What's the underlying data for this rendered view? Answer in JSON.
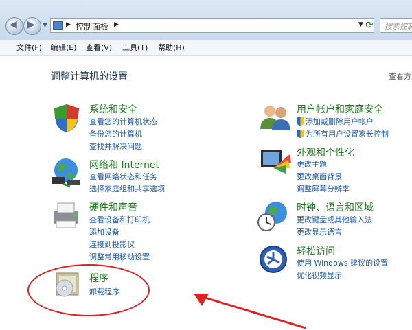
{
  "address": {
    "crumb": "控制面板",
    "search_placeholder": "搜索控制面"
  },
  "menu": [
    "文件(F)",
    "编辑(E)",
    "查看(V)",
    "工具(T)",
    "帮助(H)"
  ],
  "page": {
    "heading": "调整计算机的设置",
    "view_by": "查看方式"
  },
  "categories": {
    "system": {
      "title": "系统和安全",
      "links": [
        "查看您的计算机状态",
        "备份您的计算机",
        "查找并解决问题"
      ]
    },
    "network": {
      "title": "网络和 Internet",
      "links": [
        "查看网络状态和任务",
        "选择家庭组和共享选项"
      ]
    },
    "hardware": {
      "title": "硬件和声音",
      "links": [
        "查看设备和打印机",
        "添加设备",
        "连接到投影仪",
        "调整常用移动设置"
      ]
    },
    "programs": {
      "title": "程序",
      "links": [
        "卸载程序"
      ]
    },
    "users": {
      "title": "用户帐户和家庭安全",
      "links": [
        "添加或删除用户帐户",
        "为所有用户设置家长控制"
      ]
    },
    "appearance": {
      "title": "外观和个性化",
      "links": [
        "更改主题",
        "更改桌面背景",
        "调整屏幕分辨率"
      ]
    },
    "clock": {
      "title": "时钟、语言和区域",
      "links": [
        "更改键盘或其他输入法",
        "更改显示语言"
      ]
    },
    "ease": {
      "title": "轻松访问",
      "links": [
        "使用 Windows 建议的设置",
        "优化视频显示"
      ]
    }
  },
  "colors": {
    "category_title": "#1e7c1e",
    "link": "#1c59b3",
    "annotation": "#e02020"
  }
}
